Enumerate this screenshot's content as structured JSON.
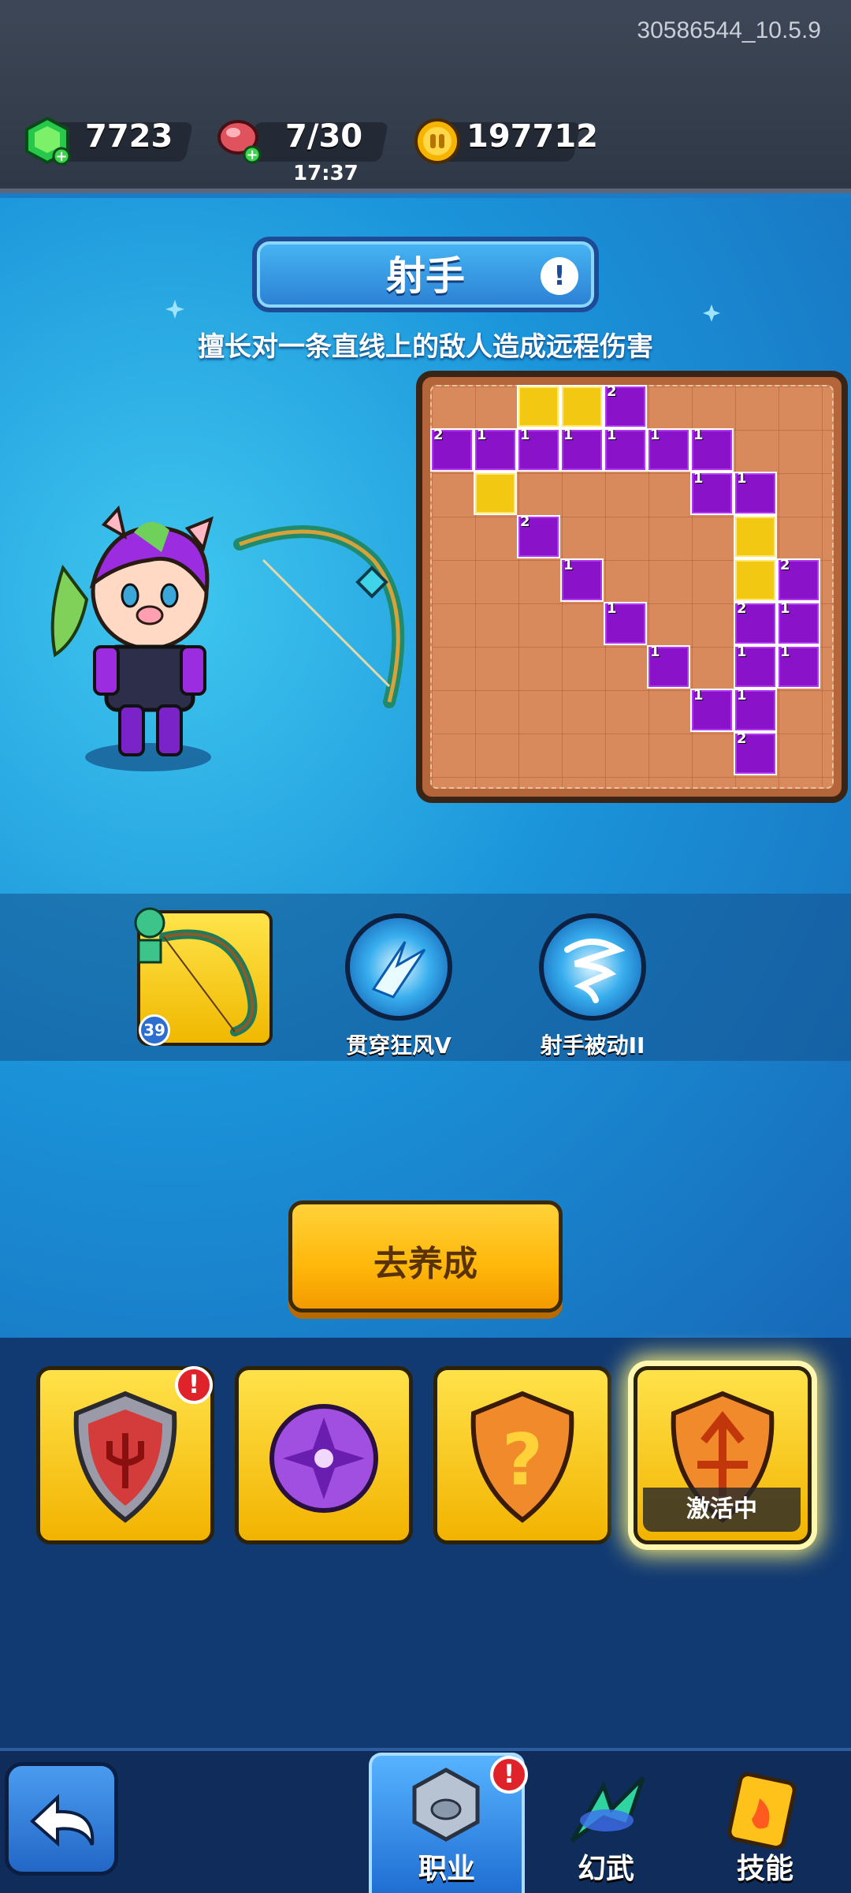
{
  "header": {
    "version": "30586544_10.5.9",
    "gems": "7723",
    "energy": "7/30",
    "energy_timer": "17:37",
    "coins": "197712"
  },
  "class_info": {
    "title": "射手",
    "info_icon": "!",
    "description": "擅长对一条直线上的敌人造成远程伤害"
  },
  "weapon": {
    "level": "39"
  },
  "skills": [
    {
      "label": "贯穿狂风V"
    },
    {
      "label": "射手被动II"
    }
  ],
  "cta": {
    "label": "去养成"
  },
  "classes": [
    {
      "name": "class-warrior",
      "badge": "!"
    },
    {
      "name": "class-mage",
      "badge": ""
    },
    {
      "name": "class-locked",
      "badge": ""
    },
    {
      "name": "class-archer",
      "status": "激活中"
    }
  ],
  "nav": {
    "tabs": [
      {
        "label": "职业"
      },
      {
        "label": "幻武"
      },
      {
        "label": "技能"
      }
    ],
    "badge": "!"
  },
  "grid_numbers": [
    "2",
    "2",
    "1",
    "1",
    "1",
    "1",
    "1",
    "1",
    "2",
    "1",
    "1",
    "1",
    "2",
    "2",
    "1",
    "1",
    "1",
    "1",
    "1",
    "2"
  ]
}
